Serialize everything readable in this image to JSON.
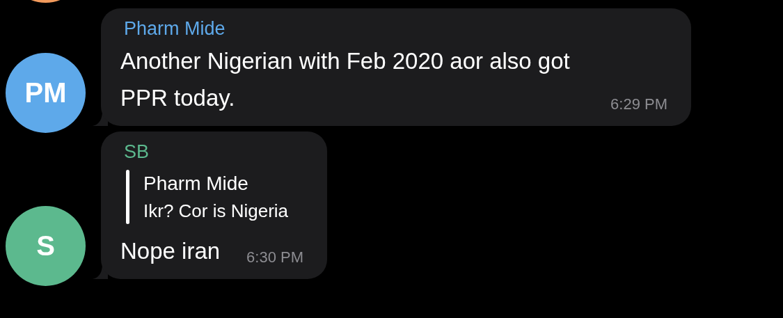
{
  "messages": [
    {
      "kind": "cutoff",
      "color": "#f29a5c"
    },
    {
      "kind": "text",
      "avatar": "PM",
      "color": "#5ea9ea",
      "sender": "Pharm Mide",
      "text": "Another Nigerian with Feb 2020 aor also got PPR today.",
      "time": "6:29 PM"
    },
    {
      "kind": "reply",
      "avatar": "S",
      "color": "#5cb98e",
      "sender": "SB",
      "reply_to": {
        "sender": "Pharm Mide",
        "text": "Ikr? Cor is Nigeria"
      },
      "text": "Nope iran",
      "time": "6:30 PM"
    }
  ]
}
